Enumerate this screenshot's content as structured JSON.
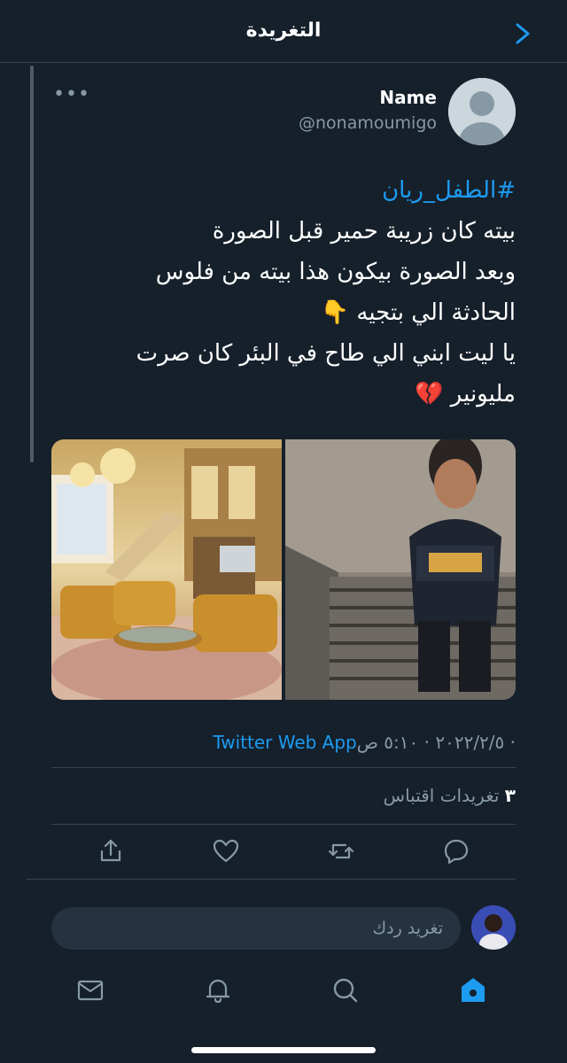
{
  "header": {
    "title": "التغريدة"
  },
  "tweet": {
    "author_name": "Name",
    "author_handle": "@nonamoumigo",
    "hashtag": "#الطفل_ريان",
    "lines": [
      "بيته كان زريبة حمير قبل الصورة",
      "وبعد الصورة بيكون هذا بيته من فلوس",
      "الحادثة الي بتجيه 👇",
      "يا ليت ابني الي طاح في البئر كان صرت",
      "مليونير 💔"
    ],
    "timestamp": "٢٠٢٢/٢/٥ · ٥:١٠ ص · ",
    "source_app": "Twitter Web App",
    "quote_count": "٣",
    "quote_label": "تغريدات اقتباس"
  },
  "reply": {
    "placeholder": "تغريد ردك"
  },
  "colors": {
    "background": "#15202b",
    "accent": "#1d9bf0",
    "muted": "#8899a6",
    "divider": "#38444d"
  }
}
